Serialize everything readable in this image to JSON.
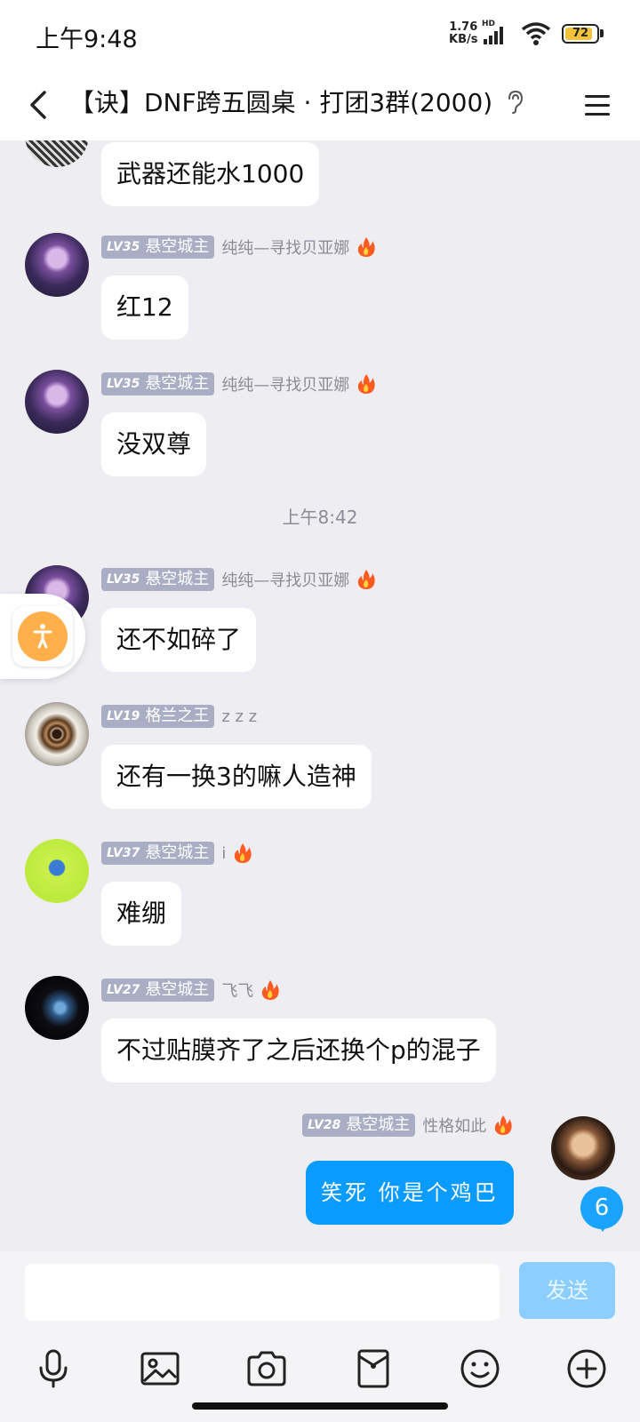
{
  "status": {
    "time": "上午9:48",
    "net_speed_value": "1.76",
    "net_speed_unit": "KB/s",
    "hd": "HD",
    "battery": "72"
  },
  "header": {
    "title": "【诀】DNF跨五圆桌 · 打团3群(2000)"
  },
  "messages": [
    {
      "text": "武器还能水1000"
    },
    {
      "level": "LV35",
      "title": "悬空城主",
      "nick": "纯纯—寻找贝亚娜",
      "text": "红12"
    },
    {
      "level": "LV35",
      "title": "悬空城主",
      "nick": "纯纯—寻找贝亚娜",
      "text": "没双尊"
    },
    {
      "level": "LV35",
      "title": "悬空城主",
      "nick": "纯纯—寻找贝亚娜",
      "text": "还不如碎了"
    },
    {
      "level": "LV19",
      "title": "格兰之王",
      "nick": "z z z",
      "text": "还有一换3的嘛人造神"
    },
    {
      "level": "LV37",
      "title": "悬空城主",
      "nick": "i",
      "text": "难绷"
    },
    {
      "level": "LV27",
      "title": "悬空城主",
      "nick": "飞飞",
      "text": "不过贴膜齐了之后还换个p的混子"
    },
    {
      "level": "LV28",
      "title": "悬空城主",
      "nick": "性格如此",
      "text": "笑死 你是个鸡巴"
    }
  ],
  "timestamp": "上午8:42",
  "unread_count": "6",
  "input": {
    "placeholder": "",
    "send_label": "发送"
  },
  "colors": {
    "self_bubble": "#0a9bff",
    "badge": "#a9aec4",
    "send_disabled": "#8ccfff"
  },
  "icons": [
    "back-arrow-icon",
    "ear-icon",
    "menu-icon",
    "fire-icon",
    "accessibility-icon",
    "microphone-icon",
    "image-icon",
    "camera-icon",
    "red-packet-icon",
    "emoji-icon",
    "plus-icon"
  ]
}
